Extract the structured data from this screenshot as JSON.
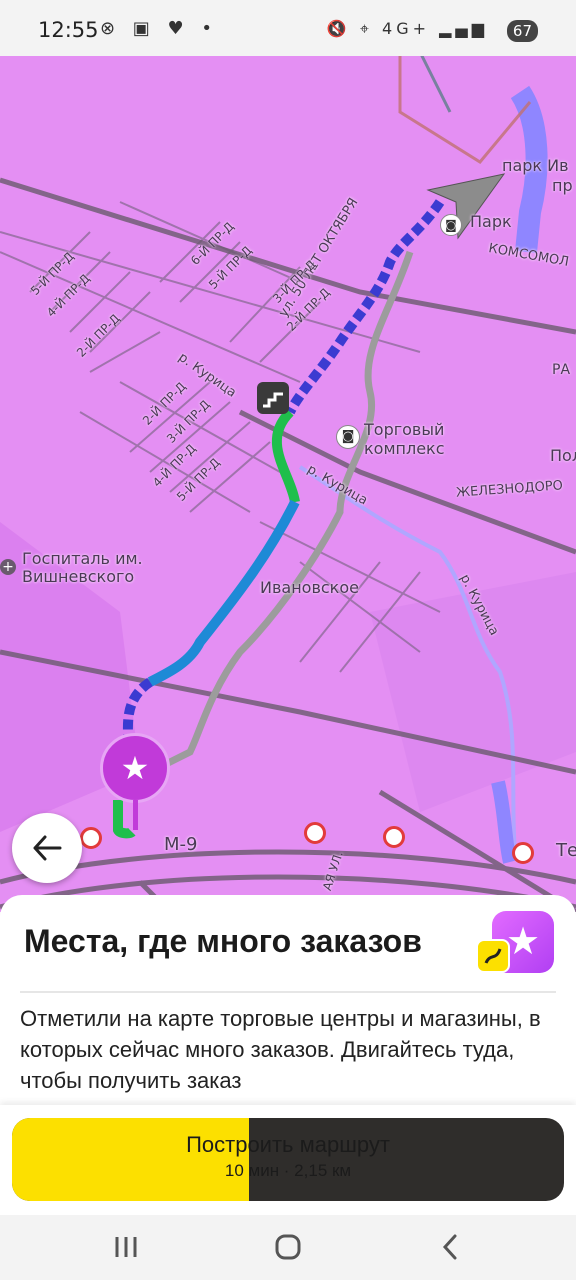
{
  "status_bar": {
    "time": "12:55",
    "left_icons": "⊗ ▣ ♥ •",
    "right_icons": "🔇 ⌖ 4G+ ▂▄▆",
    "battery": "67"
  },
  "map": {
    "labels": {
      "street_50let": "ул. 50 ЛЕТ ОКТЯБРЯ",
      "park": "Парк",
      "park_ivan": "парк Ив",
      "park_ivan2": "пр",
      "komsomol": "КОМСОМОЛ",
      "ra": "РА",
      "pol": "Пол",
      "trade_center": "Торговый комплекс",
      "river1": "р. Курица",
      "river2": "р. Курица",
      "river3": "р. Курица",
      "railway": "ЖЕЛЕЗНОДОРО",
      "hospital": "Госпиталь им. Вишневского",
      "ivanovskoe": "Ивановское",
      "m9": "М-9",
      "te": "Те",
      "aya": "АЯ УЛ.",
      "lane5a": "5-Й ПР-Д",
      "lane4a": "4-Й ПР-Д",
      "lane2a": "2-Й ПР-Д",
      "lane6b": "6-Й ПР-Д",
      "lane5b": "5-Й ПР-Д",
      "lane3c": "3-Й ПР-Д",
      "lane2c": "2-Й ПР-Д",
      "lane2d": "2-Й ПР-Д",
      "lane3d": "3-Й ПР-Д",
      "lane4d": "4-Й ПР-Д",
      "lane5d": "5-Й ПР-Д"
    }
  },
  "sheet": {
    "title": "Места, где много заказов",
    "description": "Отметили на карте торговые центры и магазины, в которых сейчас много заказов. Двигайтесь туда, чтобы получить заказ"
  },
  "cta": {
    "label": "Построить маршрут",
    "sub": "10 мин · 2,15 км",
    "progress": 0.43
  },
  "colors": {
    "map_bg": "#e48ff3",
    "accent_yellow": "#fce000",
    "route_blue": "#1e8ad6",
    "route_green": "#1fbf4c",
    "marker_purple": "#c13ad9"
  },
  "icons": {
    "back": "arrow-left-icon",
    "marker": "star-icon",
    "feature": "star-icon",
    "stairs": "stairs-icon",
    "shop": "shopping-bag-icon",
    "camera": "speed-camera-icon",
    "hospital": "plus-icon",
    "nav_recent": "recent-apps-icon",
    "nav_home": "home-icon",
    "nav_back": "back-icon"
  }
}
